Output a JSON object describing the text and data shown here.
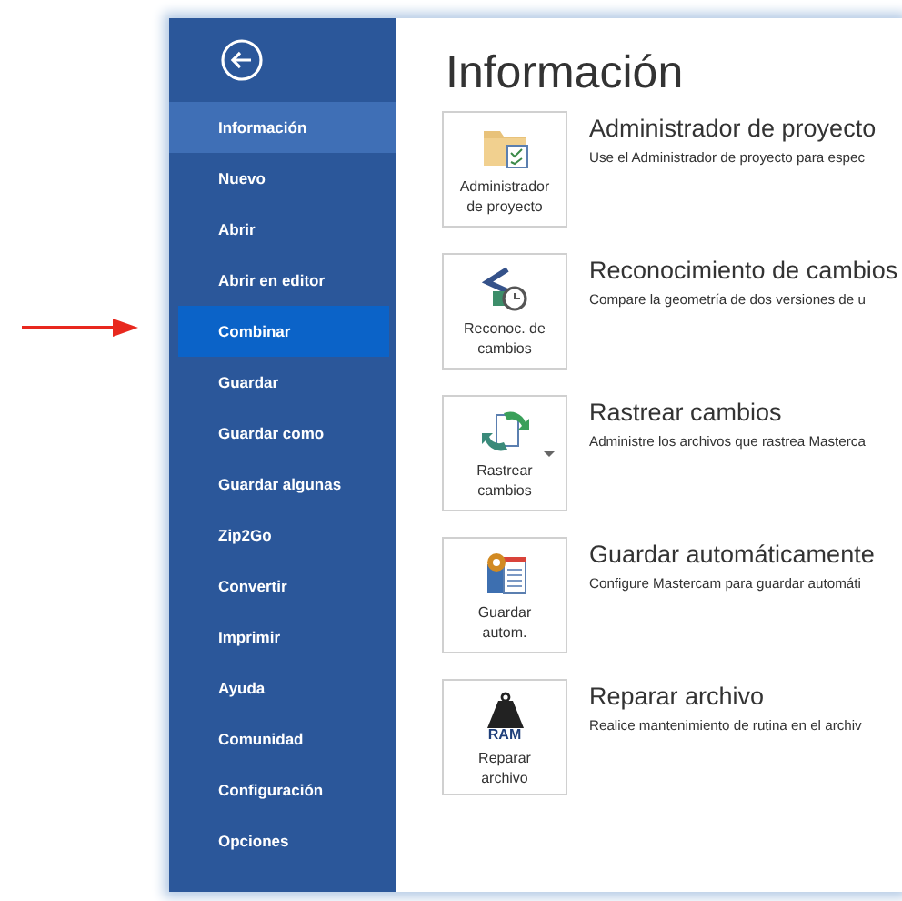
{
  "sidebar": {
    "items": [
      {
        "label": "Información",
        "selected": true,
        "hovered": false
      },
      {
        "label": "Nuevo",
        "selected": false,
        "hovered": false
      },
      {
        "label": "Abrir",
        "selected": false,
        "hovered": false
      },
      {
        "label": "Abrir en editor",
        "selected": false,
        "hovered": false
      },
      {
        "label": "Combinar",
        "selected": false,
        "hovered": true
      },
      {
        "label": "Guardar",
        "selected": false,
        "hovered": false
      },
      {
        "label": "Guardar como",
        "selected": false,
        "hovered": false
      },
      {
        "label": "Guardar algunas",
        "selected": false,
        "hovered": false
      },
      {
        "label": "Zip2Go",
        "selected": false,
        "hovered": false
      },
      {
        "label": "Convertir",
        "selected": false,
        "hovered": false
      },
      {
        "label": "Imprimir",
        "selected": false,
        "hovered": false
      },
      {
        "label": "Ayuda",
        "selected": false,
        "hovered": false
      },
      {
        "label": "Comunidad",
        "selected": false,
        "hovered": false
      },
      {
        "label": "Configuración",
        "selected": false,
        "hovered": false
      },
      {
        "label": "Opciones",
        "selected": false,
        "hovered": false
      }
    ]
  },
  "page_title": "Información",
  "sections": [
    {
      "kind": "folder",
      "button": [
        "Administrador",
        "de proyecto"
      ],
      "dropdown": false,
      "title": "Administrador de proyecto",
      "description": "Use el Administrador de proyecto para espec"
    },
    {
      "kind": "compare",
      "button": [
        "Reconoc. de",
        "cambios"
      ],
      "dropdown": false,
      "title": "Reconocimiento de cambios",
      "description": "Compare la geometría de dos versiones de u"
    },
    {
      "kind": "sync",
      "button": [
        "Rastrear",
        "cambios"
      ],
      "dropdown": true,
      "title": "Rastrear cambios",
      "description": "Administre los archivos que rastrea Masterca"
    },
    {
      "kind": "autosave",
      "button": [
        "Guardar",
        "autom."
      ],
      "dropdown": false,
      "title": "Guardar automáticamente",
      "description": "Configure Mastercam para guardar automáti"
    },
    {
      "kind": "weight",
      "icon_text": "RAM",
      "button": [
        "Reparar",
        "archivo"
      ],
      "dropdown": false,
      "title": "Reparar archivo",
      "description": "Realice mantenimiento de rutina en el archiv"
    }
  ]
}
